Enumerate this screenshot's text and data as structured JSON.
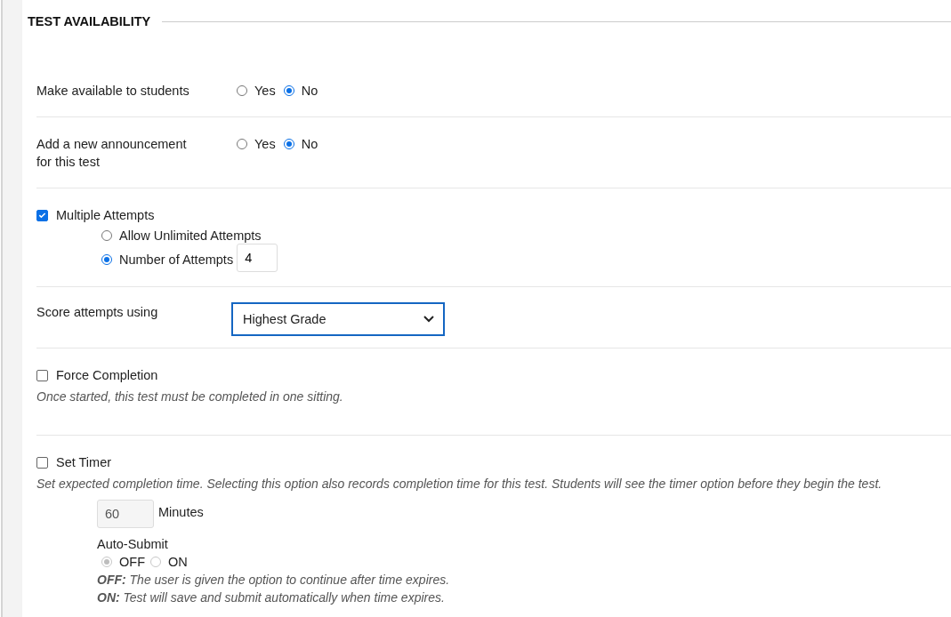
{
  "section": {
    "title": "TEST AVAILABILITY"
  },
  "rows": [
    {
      "kind": "radio",
      "label": "Make available to students",
      "options": [
        {
          "label": "Yes",
          "selected": false
        },
        {
          "label": "No",
          "selected": true
        }
      ]
    },
    {
      "kind": "radio",
      "label": "Add a new announcement for this test",
      "options": [
        {
          "label": "Yes",
          "selected": false
        },
        {
          "label": "No",
          "selected": true
        }
      ]
    },
    {
      "kind": "attempts",
      "label": "Multiple Attempts",
      "checked": true,
      "options": [
        {
          "label": "Allow Unlimited Attempts",
          "selected": false
        },
        {
          "label": "Number of Attempts",
          "selected": true,
          "value": "4"
        }
      ]
    },
    {
      "kind": "select",
      "label": "Score attempts using",
      "value": "Highest Grade"
    },
    {
      "kind": "check",
      "label": "Force Completion",
      "checked": false,
      "hint": "Once started, this test must be completed in one sitting."
    },
    {
      "kind": "timer",
      "label": "Set Timer",
      "checked": false,
      "hint": "Set expected completion time. Selecting this option also records completion time for this test. Students will see the timer option before they begin the test.",
      "minutes": {
        "value": "60",
        "disabled": true
      },
      "unit": "Minutes",
      "auto_submit": {
        "label": "Auto-Submit",
        "disabled": true,
        "options": [
          {
            "label": "OFF",
            "selected": true
          },
          {
            "label": "ON",
            "selected": false
          }
        ]
      },
      "notes": [
        "**OFF:** The user is given the option to continue after time expires.",
        "**ON:** Test will save and submit automatically when time expires."
      ]
    }
  ]
}
